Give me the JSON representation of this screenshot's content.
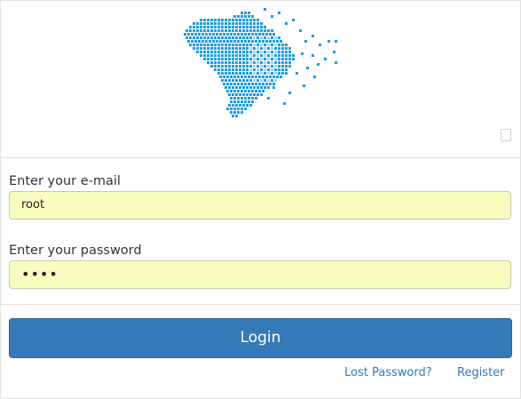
{
  "logo": {
    "name": "brazil-map-logo",
    "color": "#1e9ce0",
    "light_color": "#9fd2ef"
  },
  "form": {
    "email_label": "Enter your e-mail",
    "email_value": "root",
    "password_label": "Enter your password",
    "password_value": "••••",
    "field_background": "#fafdc0"
  },
  "actions": {
    "login_label": "Login",
    "login_color": "#337ab7",
    "lost_password_label": "Lost Password?",
    "register_label": "Register"
  }
}
